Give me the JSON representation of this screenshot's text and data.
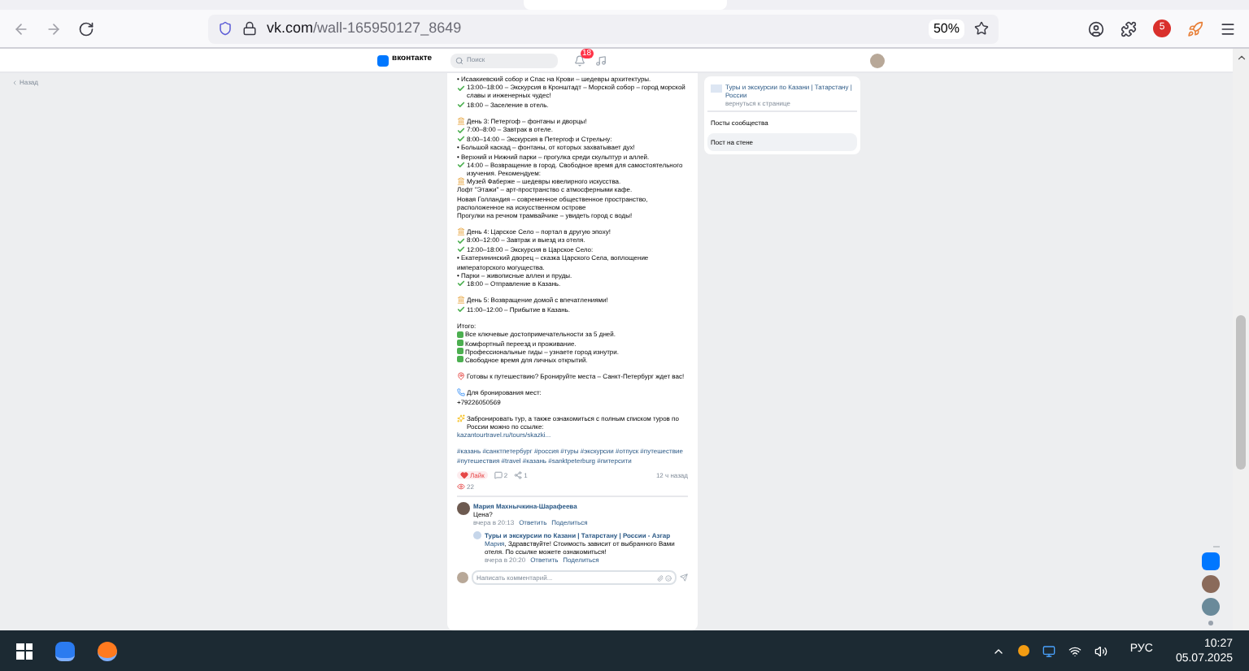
{
  "browser": {
    "url_host": "vk.com",
    "url_path": "/wall-165950127_8649",
    "zoom": "50%",
    "badge": "5"
  },
  "header": {
    "logo": "вконтакте",
    "search_placeholder": "Поиск",
    "notifications": "18"
  },
  "back": "Назад",
  "post": {
    "paragraphs": [
      [
        {
          "kind": "bullet",
          "text": "• Исаакиевский собор и Спас на Крови – шедевры архитектуры."
        },
        {
          "kind": "check",
          "text": "13:00–18:00 – Экскурсия в Кронштадт – Морской собор – город морской славы и инженерных чудес!"
        },
        {
          "kind": "check",
          "text": "18:00 – Заселение в отель."
        }
      ],
      [
        {
          "kind": "day",
          "text": "День 3: Петергоф – фонтаны и дворцы!"
        },
        {
          "kind": "check",
          "text": "7:00–8:00 – Завтрак в отеле."
        },
        {
          "kind": "check",
          "text": "8:00–14:00 – Экскурсия в Петергоф и Стрельну:"
        },
        {
          "kind": "bullet",
          "text": "• Большой каскад – фонтаны, от которых захватывает дух!"
        },
        {
          "kind": "bullet",
          "text": "• Верхний и Нижний парки – прогулка среди скульптур и аллей."
        },
        {
          "kind": "check",
          "text": "14:00 – Возвращение в город. Свободное время для самостоятельного изучения. Рекомендуем:"
        },
        {
          "kind": "day",
          "text": "Музей Фаберже – шедевры ювелирного искусства."
        },
        {
          "kind": "bullet",
          "text": "Лофт \"Этажи\" – арт-пространство с атмосферными кафе."
        },
        {
          "kind": "bullet",
          "text": "Новая Голландия – современное общественное пространство, расположенное на искусственном острове"
        },
        {
          "kind": "bullet",
          "text": "Прогулки на речном трамвайчике – увидеть город с воды!"
        }
      ],
      [
        {
          "kind": "day",
          "text": "День 4: Царское Село – портал в другую эпоху!"
        },
        {
          "kind": "check",
          "text": "8:00–12:00 – Завтрак и выезд из отеля."
        },
        {
          "kind": "check",
          "text": "12:00–18:00 – Экскурсия в Царское Село:"
        },
        {
          "kind": "bullet",
          "text": "• Екатерининский дворец – сказка Царского Села, воплощение императорского могущества."
        },
        {
          "kind": "bullet",
          "text": "• Парки – живописные аллеи и пруды."
        },
        {
          "kind": "check",
          "text": "18:00 – Отправление в Казань."
        }
      ],
      [
        {
          "kind": "day",
          "text": "День 5: Возвращение домой с впечатлениями!"
        },
        {
          "kind": "check",
          "text": "11:00–12:00 – Прибытие в Казань."
        }
      ],
      [
        {
          "kind": "bullet",
          "text": "Итого:"
        },
        {
          "kind": "box",
          "text": "Все ключевые достопримечательности за 5 дней."
        },
        {
          "kind": "box",
          "text": "Комфортный переезд и проживание."
        },
        {
          "kind": "box",
          "text": "Профессиональные гиды – узнаете город изнутри."
        },
        {
          "kind": "box",
          "text": "Свободное время для личных открытий."
        }
      ],
      [
        {
          "kind": "pin",
          "text": "Готовы к путешествию? Бронируйте места – Санкт-Петербург ждет вас!"
        }
      ],
      [
        {
          "kind": "phone",
          "text": "Для бронирования мест:"
        },
        {
          "kind": "bullet",
          "text": "+79226050569"
        }
      ],
      [
        {
          "kind": "spark",
          "text": "Забронировать тур, а также ознакомиться с полным списком туров по России можно по ссылке:"
        },
        {
          "kind": "link",
          "text": "kazantourtravel.ru/tours/skazki..."
        }
      ]
    ],
    "hashtags": "#казань #санктпетербург #россия #туры #экскурсии #отпуск #путешествие #путешествия #travel #казань #sanktpeterburg #питерсити",
    "like": "Лайк",
    "liked": true,
    "comments": "2",
    "shares": "1",
    "time": "12 ч назад",
    "reactions": "22"
  },
  "comments": [
    {
      "author": "Мария Махнычкина-Шарафеева",
      "text": "Цена?",
      "date": "вчера в 20:13",
      "reply": "Ответить",
      "share": "Поделиться",
      "nested": false
    },
    {
      "author": "Туры и экскурсии по Казани | Татарстану | России - Азгар",
      "mention": "Мария",
      "text": ", Здравствуйте! Стоимость зависит от выбранного Вами отеля. По ссылке можете ознакомиться!",
      "date": "вчера в 20:20",
      "reply": "Ответить",
      "share": "Поделиться",
      "nested": true
    }
  ],
  "comment_placeholder": "Написать комментарий...",
  "side": {
    "group": "Туры и экскурсии по Казани | Татарстану | России",
    "back_link": "вернуться к странице",
    "items": [
      {
        "label": "Посты сообщества",
        "selected": false
      },
      {
        "label": "Пост на стене",
        "selected": true
      }
    ]
  },
  "taskbar": {
    "lang": "РУС",
    "time": "10:27",
    "date": "05.07.2025"
  }
}
